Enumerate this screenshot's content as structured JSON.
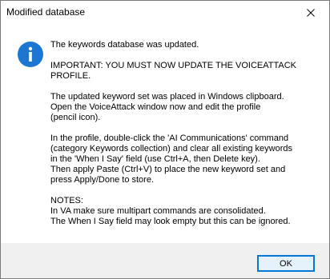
{
  "window": {
    "title": "Modified database",
    "close_icon": "close-icon"
  },
  "dialog": {
    "icon": "info-icon",
    "messages": [
      "The keywords database was updated.",
      "IMPORTANT: YOU MUST NOW UPDATE THE VOICEATTACK\nPROFILE.",
      "The updated keyword set was placed in Windows clipboard.\nOpen the VoiceAttack window now and edit the profile\n(pencil icon).",
      "In the profile, double-click the 'AI Communications' command\n(category Keywords collection) and clear all existing keywords\nin the 'When I Say' field (use Ctrl+A, then Delete key).\nThen apply Paste (Ctrl+V) to place the new keyword set and\npress Apply/Done to store.",
      "NOTES:\nIn VA make sure multipart commands are consolidated.\nThe When I Say field may look empty but this can be ignored."
    ]
  },
  "footer": {
    "ok_label": "OK"
  },
  "colors": {
    "accent": "#0078d7",
    "footer_bg": "#f0f0f0",
    "button_bg": "#e5f1fb"
  }
}
